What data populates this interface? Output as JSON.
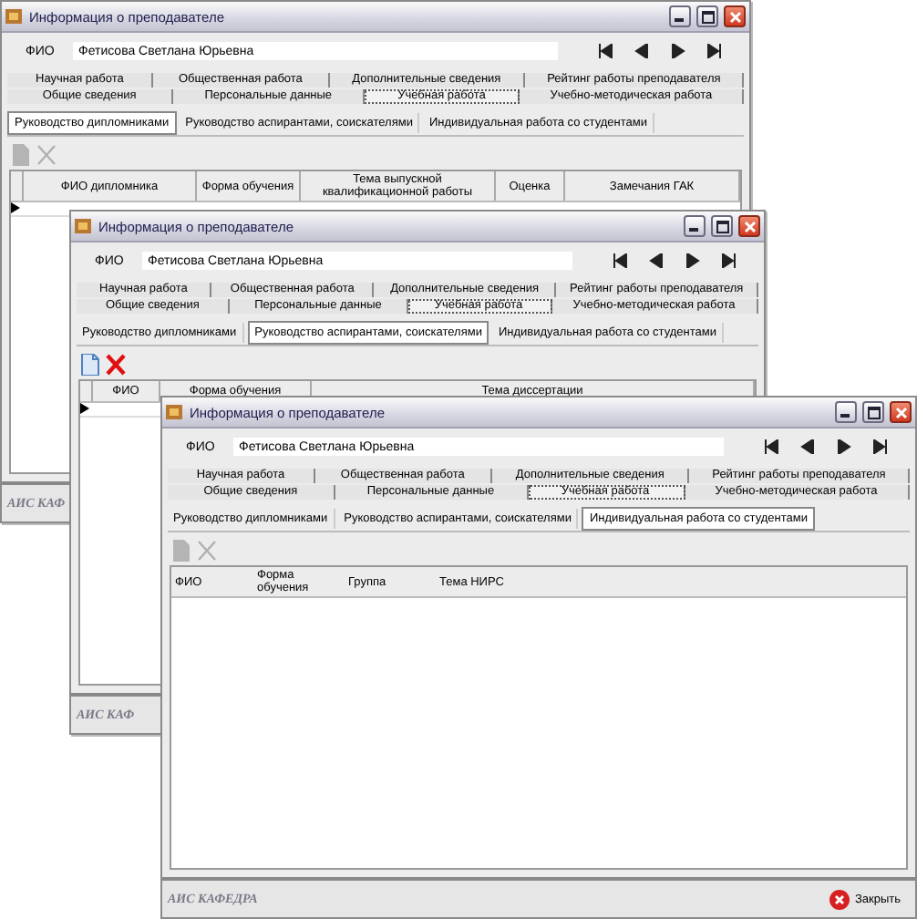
{
  "windows": [
    {
      "title": "Информация о преподавателе",
      "fio_label": "ФИО",
      "fio_value": "Фетисова Светлана Юрьевна",
      "tab_rows": [
        [
          {
            "label": "Научная работа",
            "selected": false
          },
          {
            "label": "Общественная работа",
            "selected": false
          },
          {
            "label": "Дополнительные сведения",
            "selected": false
          },
          {
            "label": "Рейтинг работы преподавателя",
            "selected": false
          }
        ],
        [
          {
            "label": "Общие сведения",
            "selected": false
          },
          {
            "label": "Персональные данные",
            "selected": false
          },
          {
            "label": "Учебная работа",
            "selected": true
          },
          {
            "label": "Учебно-методическая работа",
            "selected": false
          }
        ]
      ],
      "subtabs": [
        {
          "label": "Руководство дипломниками",
          "selected": true
        },
        {
          "label": "Руководство аспирантами, соискателями",
          "selected": false
        },
        {
          "label": "Индивидуальная работа со студентами",
          "selected": false
        }
      ],
      "toolbar_disabled": true,
      "grid_lines": true,
      "columns": [
        "ФИО дипломника",
        "Форма обучения",
        "Тема выпускной квалификационной работы",
        "Оценка",
        "Замечания ГАК"
      ],
      "new_row": true,
      "footer": "АИС КАФ"
    },
    {
      "title": "Информация о преподавателе",
      "fio_label": "ФИО",
      "fio_value": "Фетисова Светлана Юрьевна",
      "tab_rows": [
        [
          {
            "label": "Научная работа",
            "selected": false
          },
          {
            "label": "Общественная работа",
            "selected": false
          },
          {
            "label": "Дополнительные сведения",
            "selected": false
          },
          {
            "label": "Рейтинг работы преподавателя",
            "selected": false
          }
        ],
        [
          {
            "label": "Общие сведения",
            "selected": false
          },
          {
            "label": "Персональные данные",
            "selected": false
          },
          {
            "label": "Учебная работа",
            "selected": true
          },
          {
            "label": "Учебно-методическая работа",
            "selected": false
          }
        ]
      ],
      "subtabs": [
        {
          "label": "Руководство дипломниками",
          "selected": false
        },
        {
          "label": "Руководство аспирантами, соискателями",
          "selected": true
        },
        {
          "label": "Индивидуальная работа со студентами",
          "selected": false
        }
      ],
      "toolbar_disabled": false,
      "grid_lines": true,
      "columns": [
        "ФИО",
        "Форма обучения",
        "Тема диссертации"
      ],
      "new_row": true,
      "footer": "АИС КАФ"
    },
    {
      "title": "Информация о преподавателе",
      "fio_label": "ФИО",
      "fio_value": "Фетисова Светлана Юрьевна",
      "tab_rows": [
        [
          {
            "label": "Научная работа",
            "selected": false
          },
          {
            "label": "Общественная работа",
            "selected": false
          },
          {
            "label": "Дополнительные сведения",
            "selected": false
          },
          {
            "label": "Рейтинг работы преподавателя",
            "selected": false
          }
        ],
        [
          {
            "label": "Общие сведения",
            "selected": false
          },
          {
            "label": "Персональные данные",
            "selected": false
          },
          {
            "label": "Учебная работа",
            "selected": true
          },
          {
            "label": "Учебно-методическая работа",
            "selected": false
          }
        ]
      ],
      "subtabs": [
        {
          "label": "Руководство дипломниками",
          "selected": false
        },
        {
          "label": "Руководство аспирантами, соискателями",
          "selected": false
        },
        {
          "label": "Индивидуальная работа со студентами",
          "selected": true
        }
      ],
      "toolbar_disabled": true,
      "grid_lines": false,
      "columns": [
        "ФИО",
        "Форма обучения",
        "Группа",
        "Тема НИРС"
      ],
      "new_row": false,
      "footer": "АИС КАФЕДРА",
      "close_button": "Закрыть"
    }
  ]
}
